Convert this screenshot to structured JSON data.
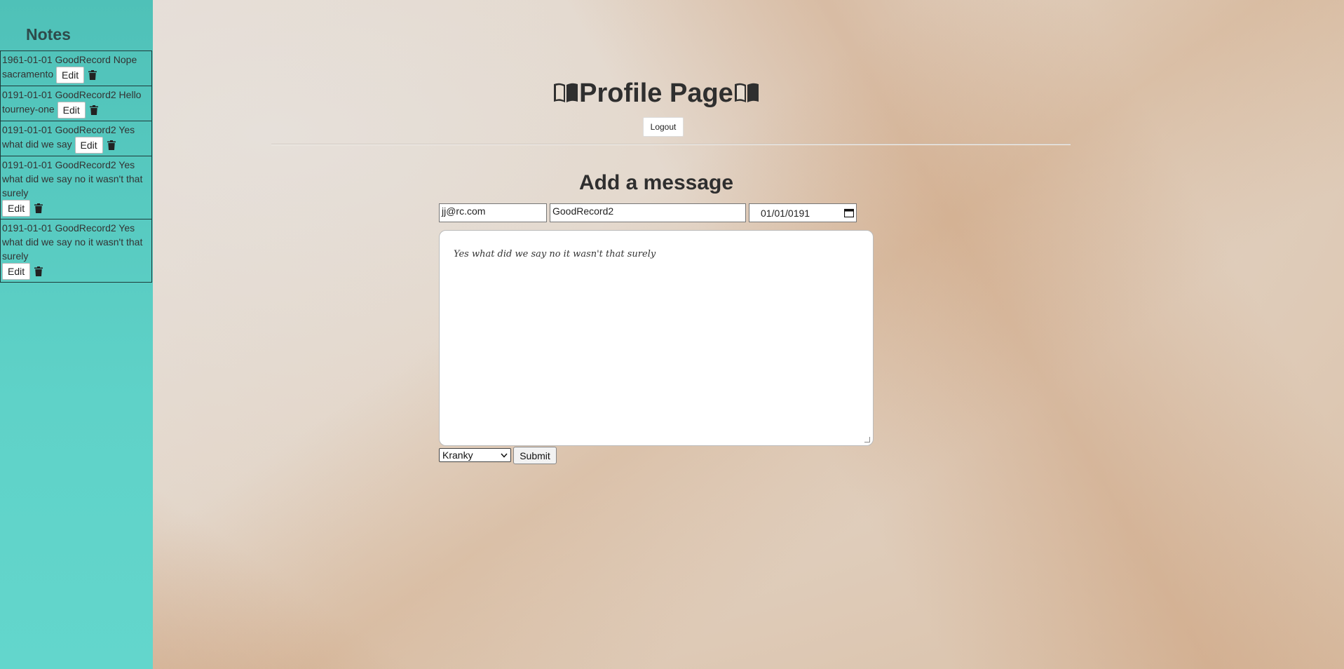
{
  "sidebar": {
    "title": "Notes",
    "edit_label": "Edit",
    "notes": [
      {
        "text": "1961-01-01 GoodRecord Nope sacramento"
      },
      {
        "text": "0191-01-01 GoodRecord2 Hello tourney-one"
      },
      {
        "text": "0191-01-01 GoodRecord2 Yes what did we say"
      },
      {
        "text": "0191-01-01 GoodRecord2 Yes what did we say no it wasn't that surely"
      },
      {
        "text": "0191-01-01 GoodRecord2 Yes what did we say no it wasn't that surely"
      }
    ]
  },
  "header": {
    "title": "Profile Page",
    "logout_label": "Logout"
  },
  "form": {
    "title": "Add a message",
    "email_value": "jj@rc.com",
    "name_value": "GoodRecord2",
    "date_value": "01/01/0191",
    "message_value": "Yes what did we say no it wasn't that surely",
    "font_selected": "Kranky",
    "submit_label": "Submit"
  },
  "icons": {
    "book": "book-open-icon",
    "trash": "trash-icon",
    "calendar": "calendar-icon",
    "chevron": "chevron-down-icon"
  },
  "colors": {
    "sidebar_bg": "#5fd2c8",
    "text_dark": "#2f2f2f"
  }
}
